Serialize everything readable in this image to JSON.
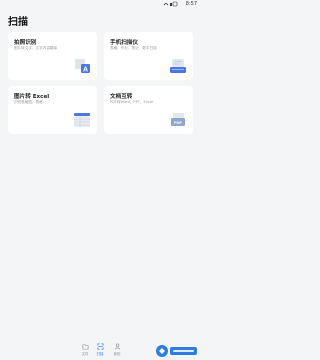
{
  "status": {
    "time": "8:57"
  },
  "page": {
    "title": "扫描"
  },
  "cards": [
    {
      "title": "拍照识别",
      "sub": "图片转文字，文字内容翻译"
    },
    {
      "title": "手机扫描仪",
      "sub": "表格、作业、笔记、数字扫描"
    },
    {
      "title": "图片转 Excel",
      "sub": "识别表格图，表格"
    },
    {
      "title": "文档互转",
      "sub": "PDF转Word、PPT、Excel"
    }
  ],
  "art": {
    "pdf_label": "PDF",
    "letter_a": "A"
  },
  "tabs": [
    {
      "label": "文件"
    },
    {
      "label": "扫描"
    },
    {
      "label": "我的"
    }
  ],
  "colors": {
    "accent": "#3a7afe",
    "excel_blue": "#4a78e0"
  }
}
